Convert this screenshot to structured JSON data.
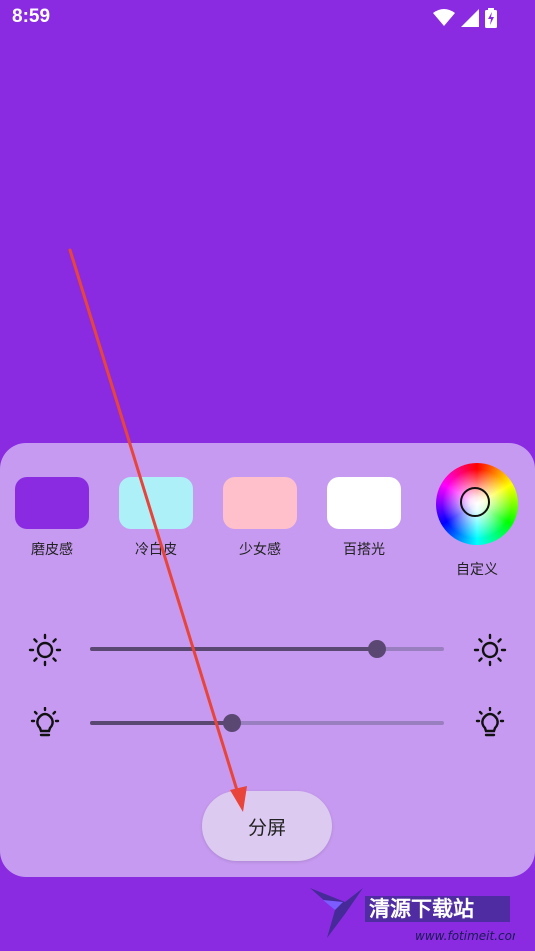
{
  "status_bar": {
    "time": "8:59",
    "icons": [
      "wifi-icon",
      "signal-icon",
      "battery-charging-icon"
    ]
  },
  "colors": {
    "background": "#8a2be2",
    "panel": "#c69af0",
    "arrow": "#e8443a"
  },
  "presets": [
    {
      "label": "磨皮感",
      "color": "#8a2be2"
    },
    {
      "label": "冷白皮",
      "color": "#aef0f8"
    },
    {
      "label": "少女感",
      "color": "#ffc0cb"
    },
    {
      "label": "百搭光",
      "color": "#ffffff"
    }
  ],
  "custom": {
    "label": "自定义",
    "icon": "color-wheel-icon"
  },
  "sliders": [
    {
      "name": "brightness",
      "icon": "sun-icon",
      "value": 0.81
    },
    {
      "name": "color-temperature",
      "icon": "bulb-icon",
      "value": 0.4
    }
  ],
  "split_button": {
    "label": "分屏"
  },
  "watermark": {
    "text": "清源下载站",
    "url": "www.fotimeit.com"
  }
}
